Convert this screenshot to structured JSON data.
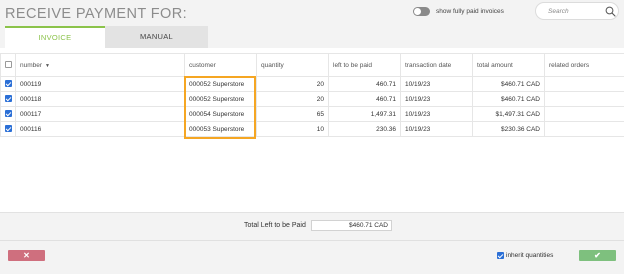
{
  "header": {
    "title": "RECEIVE PAYMENT FOR:",
    "toggle_label": "show fully paid invoices",
    "search_placeholder": "Search"
  },
  "tabs": [
    {
      "label": "INVOICE",
      "active": true
    },
    {
      "label": "MANUAL",
      "active": false
    }
  ],
  "table": {
    "columns": [
      "number",
      "customer",
      "quantity",
      "left to be paid",
      "transaction date",
      "total amount",
      "related orders"
    ],
    "sort_indicator": "▼",
    "rows": [
      {
        "checked": true,
        "number": "000119",
        "customer": "000052 Superstore",
        "quantity": "20",
        "left_to_be_paid": "460.71",
        "transaction_date": "10/19/23",
        "total_amount": "$460.71 CAD",
        "related_orders": ""
      },
      {
        "checked": true,
        "number": "000118",
        "customer": "000052 Superstore",
        "quantity": "20",
        "left_to_be_paid": "460.71",
        "transaction_date": "10/19/23",
        "total_amount": "$460.71 CAD",
        "related_orders": ""
      },
      {
        "checked": true,
        "number": "000117",
        "customer": "000054 Superstore",
        "quantity": "65",
        "left_to_be_paid": "1,497.31",
        "transaction_date": "10/19/23",
        "total_amount": "$1,497.31 CAD",
        "related_orders": ""
      },
      {
        "checked": true,
        "number": "000116",
        "customer": "000053 Superstore",
        "quantity": "10",
        "left_to_be_paid": "230.36",
        "transaction_date": "10/19/23",
        "total_amount": "$230.36 CAD",
        "related_orders": ""
      }
    ]
  },
  "footer": {
    "total_label": "Total Left to be Paid",
    "total_value": "$460.71 CAD",
    "cancel_symbol": "✕",
    "inherit_label": "inherit quantities",
    "confirm_symbol": "✔"
  },
  "colors": {
    "accent_green": "#8bc34a",
    "cancel": "#cf6f7e",
    "confirm": "#7ec07e",
    "highlight": "#f5a623",
    "checkbox": "#2b6fd6"
  },
  "icons": [
    "search-icon",
    "close-icon",
    "checkmark-icon"
  ]
}
